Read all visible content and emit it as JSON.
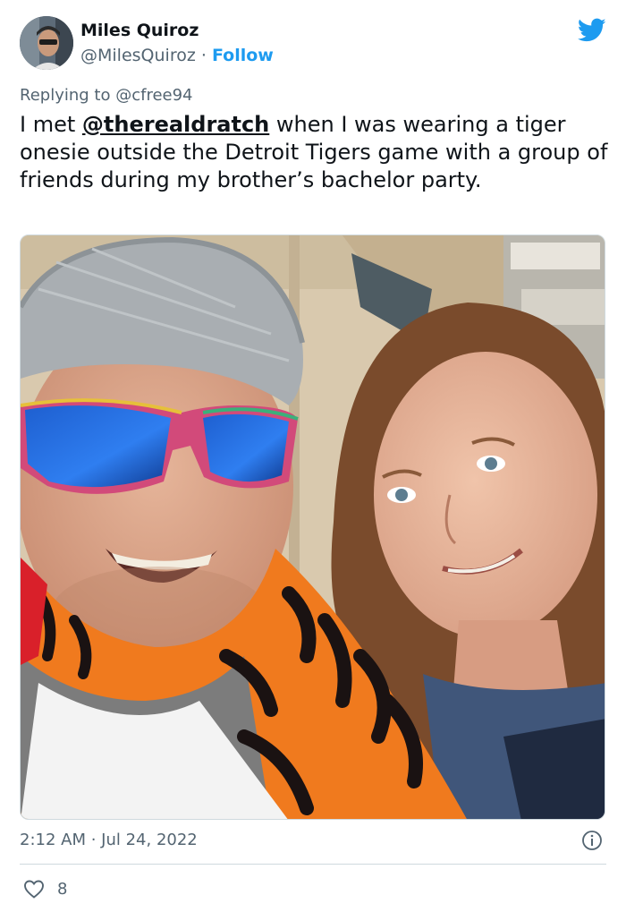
{
  "author": {
    "name": "Miles Quiroz",
    "handle": "@MilesQuiroz",
    "separator": "·",
    "follow_label": "Follow"
  },
  "reply": {
    "prefix": "Replying to",
    "to_handle": "@cfree94"
  },
  "tweet": {
    "text_before": "I met ",
    "mention": "@therealdratch",
    "text_after": " when I was wearing a tiger onesie outside the Detroit Tigers game with a group of friends during my brother’s bachelor party."
  },
  "meta": {
    "timestamp": "2:12 AM · Jul 24, 2022"
  },
  "actions": {
    "like_count": "8"
  },
  "icons": {
    "logo": "twitter-bird-icon",
    "info": "info-icon",
    "like": "heart-icon"
  },
  "colors": {
    "accent": "#1d9bf0",
    "text": "#0f1419",
    "secondary": "#536471",
    "border": "#cfd9de"
  }
}
